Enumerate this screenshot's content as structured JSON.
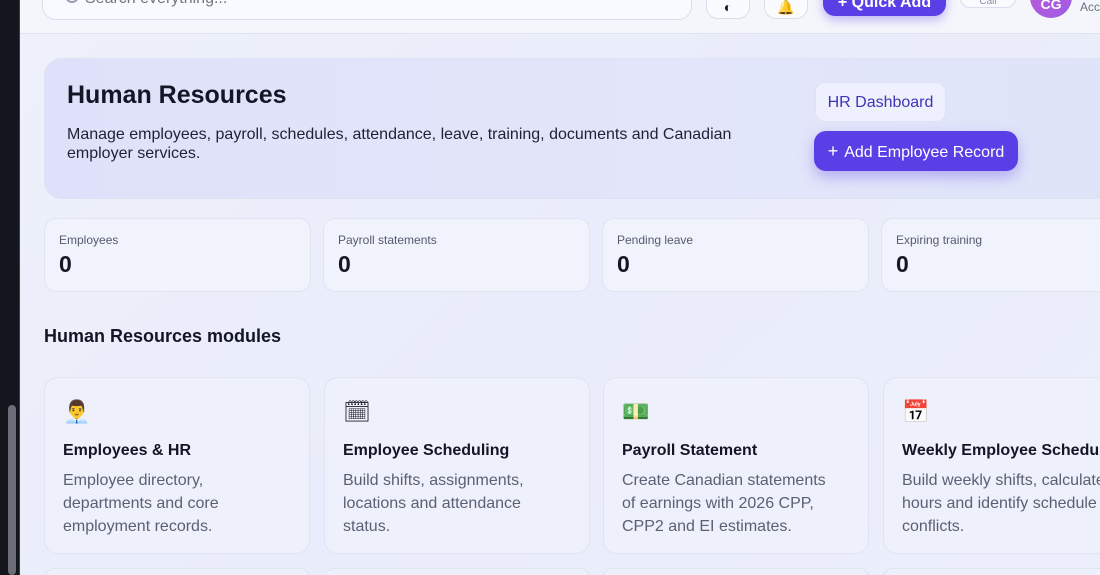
{
  "header": {
    "search_placeholder": "Search everything...",
    "theme_icon": "half-moon-icon",
    "notify_icon": "bell-icon",
    "quick_add_label": "+ Quick Add",
    "small_pill_label": "Call",
    "avatar_initials": "CG",
    "account_label": "Acc"
  },
  "hero": {
    "title": "Human Resources",
    "description": "Manage employees, payroll, schedules, attendance, leave, training, documents and Canadian employer services.",
    "dashboard_button": "HR Dashboard",
    "add_button_icon": "+",
    "add_button_label": "Add Employee Record"
  },
  "stats": [
    {
      "label": "Employees",
      "value": "0"
    },
    {
      "label": "Payroll statements",
      "value": "0"
    },
    {
      "label": "Pending leave",
      "value": "0"
    },
    {
      "label": "Expiring training",
      "value": "0"
    }
  ],
  "modules_section": {
    "title": "Human Resources modules"
  },
  "modules": [
    {
      "icon": "👨‍💼",
      "icon_name": "office-worker-icon",
      "title": "Employees & HR",
      "description": "Employee directory, departments and core employment records."
    },
    {
      "icon": "🗓",
      "icon_name": "spiral-calendar-icon",
      "title": "Employee Scheduling",
      "description": "Build shifts, assignments, locations and attendance status."
    },
    {
      "icon": "💵",
      "icon_name": "dollar-banknote-icon",
      "title": "Payroll Statement",
      "description": "Create Canadian statements of earnings with 2026 CPP, CPP2 and EI estimates."
    },
    {
      "icon": "📅",
      "icon_name": "calendar-17-icon",
      "title": "Weekly Employee Schedule",
      "description": "Build weekly shifts, calculate hours and identify schedule conflicts."
    }
  ]
}
